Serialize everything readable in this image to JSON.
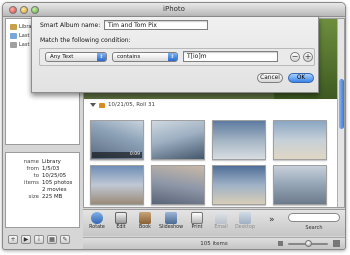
{
  "window": {
    "title": "iPhoto"
  },
  "sidebar": {
    "items": [
      {
        "label": "Library"
      },
      {
        "label": "Last Roll"
      },
      {
        "label": "Last 12 Months"
      }
    ]
  },
  "info": {
    "rows": [
      {
        "key": "name",
        "value": "Library"
      },
      {
        "key": "from",
        "value": "1/5/03"
      },
      {
        "key": "to",
        "value": "10/25/05"
      },
      {
        "key": "items",
        "value": "105 photos"
      },
      {
        "key": "",
        "value": "2 movies"
      },
      {
        "key": "size",
        "value": "225 MB"
      }
    ]
  },
  "left_buttons": {
    "add": "+",
    "play": "▶",
    "info": "i"
  },
  "dialog": {
    "name_label": "Smart Album name:",
    "name_value": "Tim and Tom Pix",
    "match_label": "Match the following condition:",
    "field_value": "Any Text",
    "operator_value": "contains",
    "text_value": "T[io]m",
    "remove_label": "−",
    "add_label": "+",
    "cancel_label": "Cancel",
    "ok_label": "OK"
  },
  "roll": {
    "title": "10/21/05, Roll 31"
  },
  "thumbs": [
    {
      "badge": "0:09"
    },
    {
      "badge": ""
    },
    {
      "badge": ""
    },
    {
      "badge": ""
    },
    {
      "badge": ""
    },
    {
      "badge": ""
    },
    {
      "badge": ""
    },
    {
      "badge": ""
    }
  ],
  "toolbar": {
    "tools": [
      {
        "label": "Rotate",
        "icon": "rotate-icon",
        "enabled": true
      },
      {
        "label": "Edit",
        "icon": "edit-icon",
        "enabled": true
      },
      {
        "label": "Book",
        "icon": "book-icon",
        "enabled": true
      },
      {
        "label": "Slideshow",
        "icon": "slideshow-icon",
        "enabled": true
      },
      {
        "label": "Print",
        "icon": "print-icon",
        "enabled": true
      },
      {
        "label": "Email",
        "icon": "email-icon",
        "enabled": false
      },
      {
        "label": "Desktop",
        "icon": "desktop-icon",
        "enabled": false
      }
    ],
    "more": "»",
    "search_label": "Search"
  },
  "status": {
    "count": "105 items",
    "zoom_level": 0.45
  },
  "colors": {
    "accent": "#3b84e6",
    "sheet": "#ececec"
  }
}
